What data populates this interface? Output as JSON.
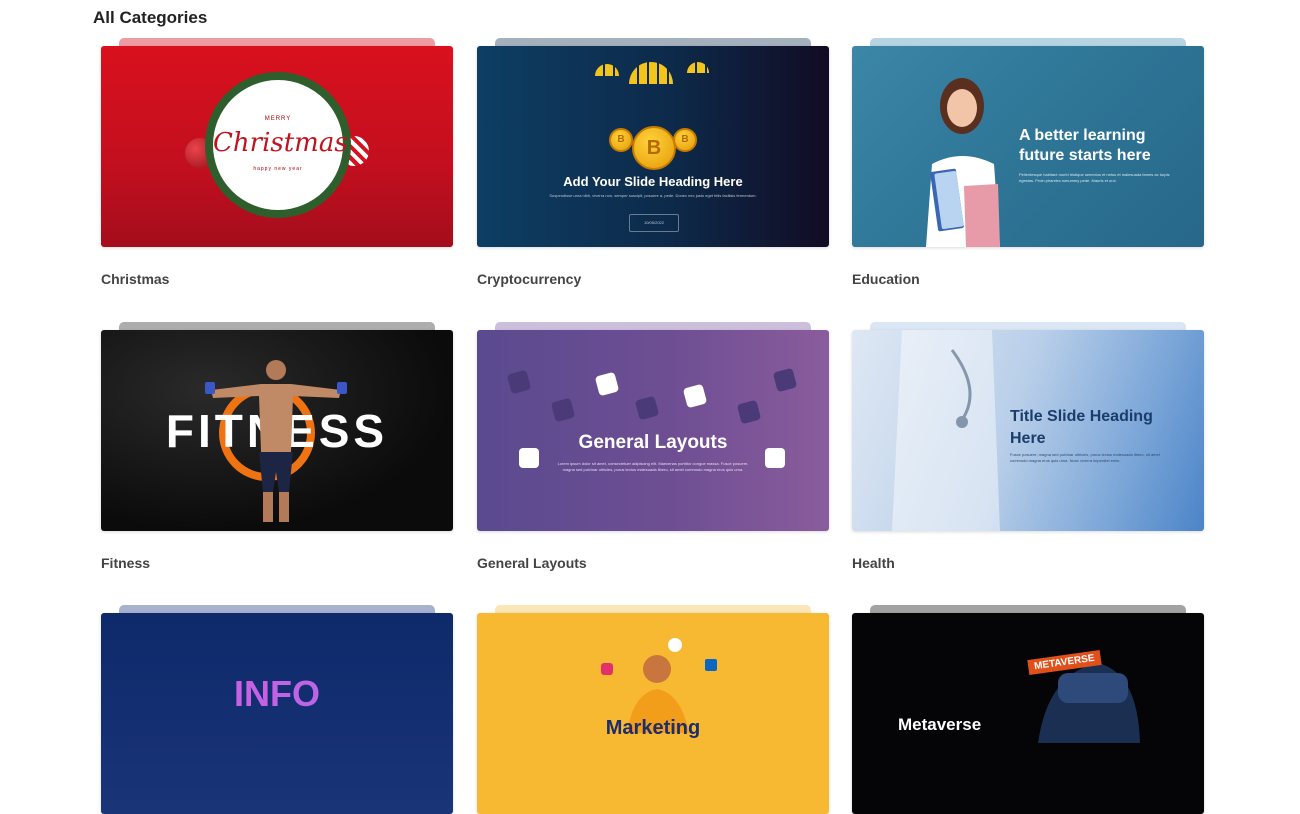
{
  "page": {
    "title": "All Categories"
  },
  "categories": [
    {
      "name": "Christmas",
      "thumb": {
        "top_small": "MERRY",
        "script": "Christmas",
        "bottom_small": "happy new year"
      }
    },
    {
      "name": "Cryptocurrency",
      "thumb": {
        "heading": "Add Your Slide Heading Here",
        "body": "Suspendisse urna nibh, viverra non, semper suscipit, posuere a, pede. Donec nec justo eget felis facilisis fermentum.",
        "date": "10/05/2022",
        "coin_symbol": "B"
      }
    },
    {
      "name": "Education",
      "thumb": {
        "heading": "A better learning future starts here",
        "body": "Pellentesque habitant morbi tristique senectus et netus et malesuada fames ac turpis egestas. Proin pharetra nonummy pede. Mauris et orci."
      }
    },
    {
      "name": "Fitness",
      "thumb": {
        "heading": "FITNESS"
      }
    },
    {
      "name": "General Layouts",
      "thumb": {
        "heading": "General Layouts",
        "body": "Lorem ipsum dolor sit amet, consectetuer adipiscing elit. Maecenas porttitor congue massa. Fusce posuere, magna sed pulvinar ultricies, purus lectus malesuada libero, sit amet commodo magna eros quis urna."
      }
    },
    {
      "name": "Health",
      "thumb": {
        "heading": "Title Slide Heading Here",
        "body": "Fusce posuere, magna sed pulvinar ultricies, purus lectus malesuada libero, sit amet commodo magna eros quis urna. Nunc viverra imperdiet enim."
      }
    },
    {
      "name": "",
      "thumb": {
        "heading": "INFO"
      }
    },
    {
      "name": "",
      "thumb": {
        "heading": "Marketing"
      }
    },
    {
      "name": "",
      "thumb": {
        "heading": "Metaverse",
        "tag": "METAVERSE"
      }
    }
  ],
  "colors": {
    "christmas": "#d9101d",
    "crypto": "#0d2a4a",
    "education": "#2e7596",
    "fitness_accent": "#ef7313",
    "general": "#6e4e93",
    "health": "#7ea8d9",
    "info": "#0e2a6a",
    "marketing": "#f8b932",
    "metaverse": "#050507"
  }
}
